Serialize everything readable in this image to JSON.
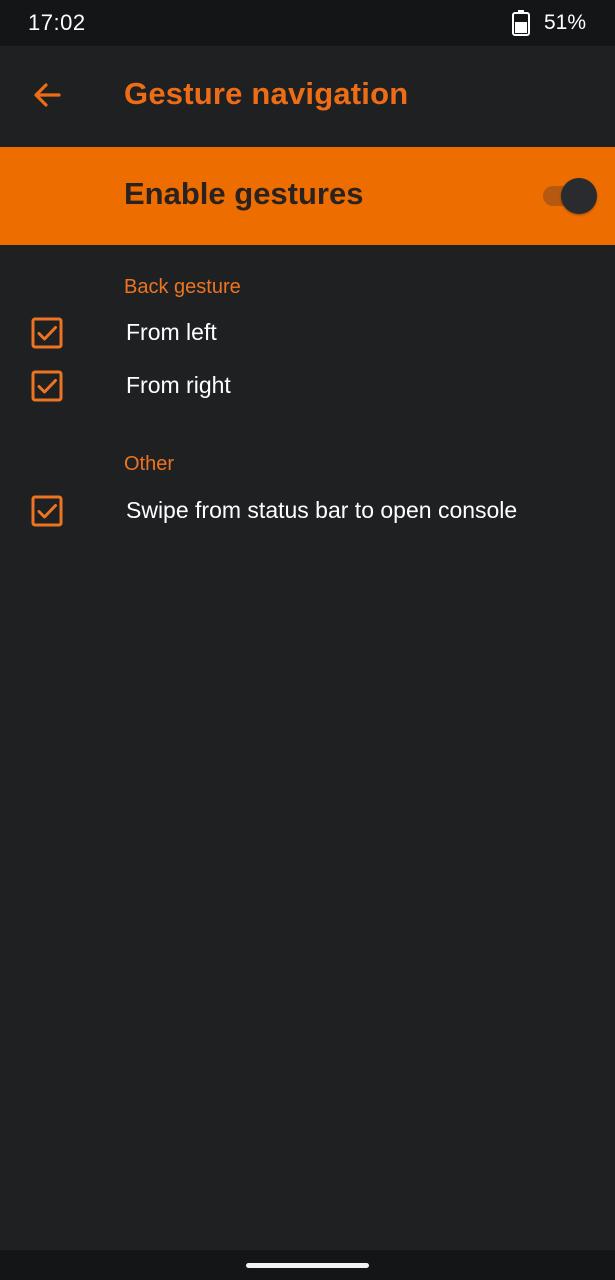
{
  "status_bar": {
    "time": "17:02",
    "battery_icon": "battery-icon",
    "battery_percent": "51%"
  },
  "toolbar": {
    "back_icon": "arrow-back-icon",
    "title": "Gesture navigation"
  },
  "master_switch": {
    "label": "Enable gestures",
    "enabled": true
  },
  "sections": [
    {
      "header": "Back gesture",
      "items": [
        {
          "label": "From left",
          "checked": true
        },
        {
          "label": "From right",
          "checked": true
        }
      ]
    },
    {
      "header": "Other",
      "items": [
        {
          "label": "Swipe from status bar to open console",
          "checked": true
        }
      ]
    }
  ],
  "colors": {
    "accent": "#ed6d00",
    "accent_text": "#ed7421",
    "background": "#1f2022",
    "status_bar": "#141516"
  }
}
